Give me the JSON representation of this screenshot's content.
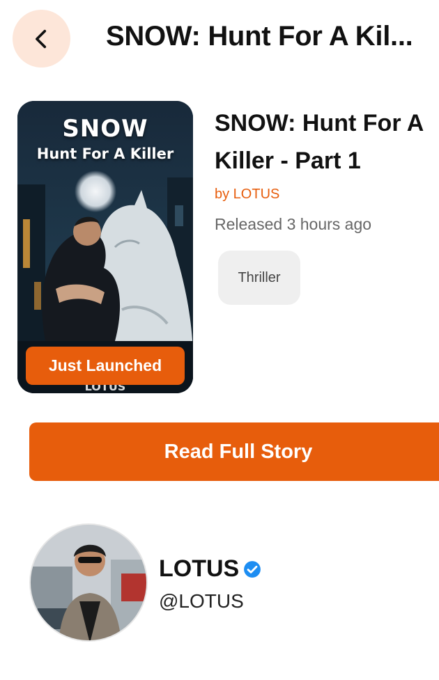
{
  "header": {
    "title": "SNOW: Hunt For A Kil..."
  },
  "book": {
    "cover_title": "SNOW",
    "cover_subtitle": "Hunt For A Killer",
    "cover_badge": "Just Launched",
    "title": "SNOW: Hunt For A Killer - Part 1",
    "author": "by LOTUS",
    "released": "Released 3 hours ago",
    "genre": "Thriller"
  },
  "actions": {
    "read_label": "Read Full Story"
  },
  "profile": {
    "name": "LOTUS",
    "handle": "@LOTUS"
  },
  "colors": {
    "accent": "#e75d0c",
    "back_bg": "#fde6d9",
    "chip_bg": "#efefef",
    "verified": "#1d8df2"
  },
  "icons": {
    "back": "chevron-left-icon",
    "verified": "verified-badge-icon"
  }
}
